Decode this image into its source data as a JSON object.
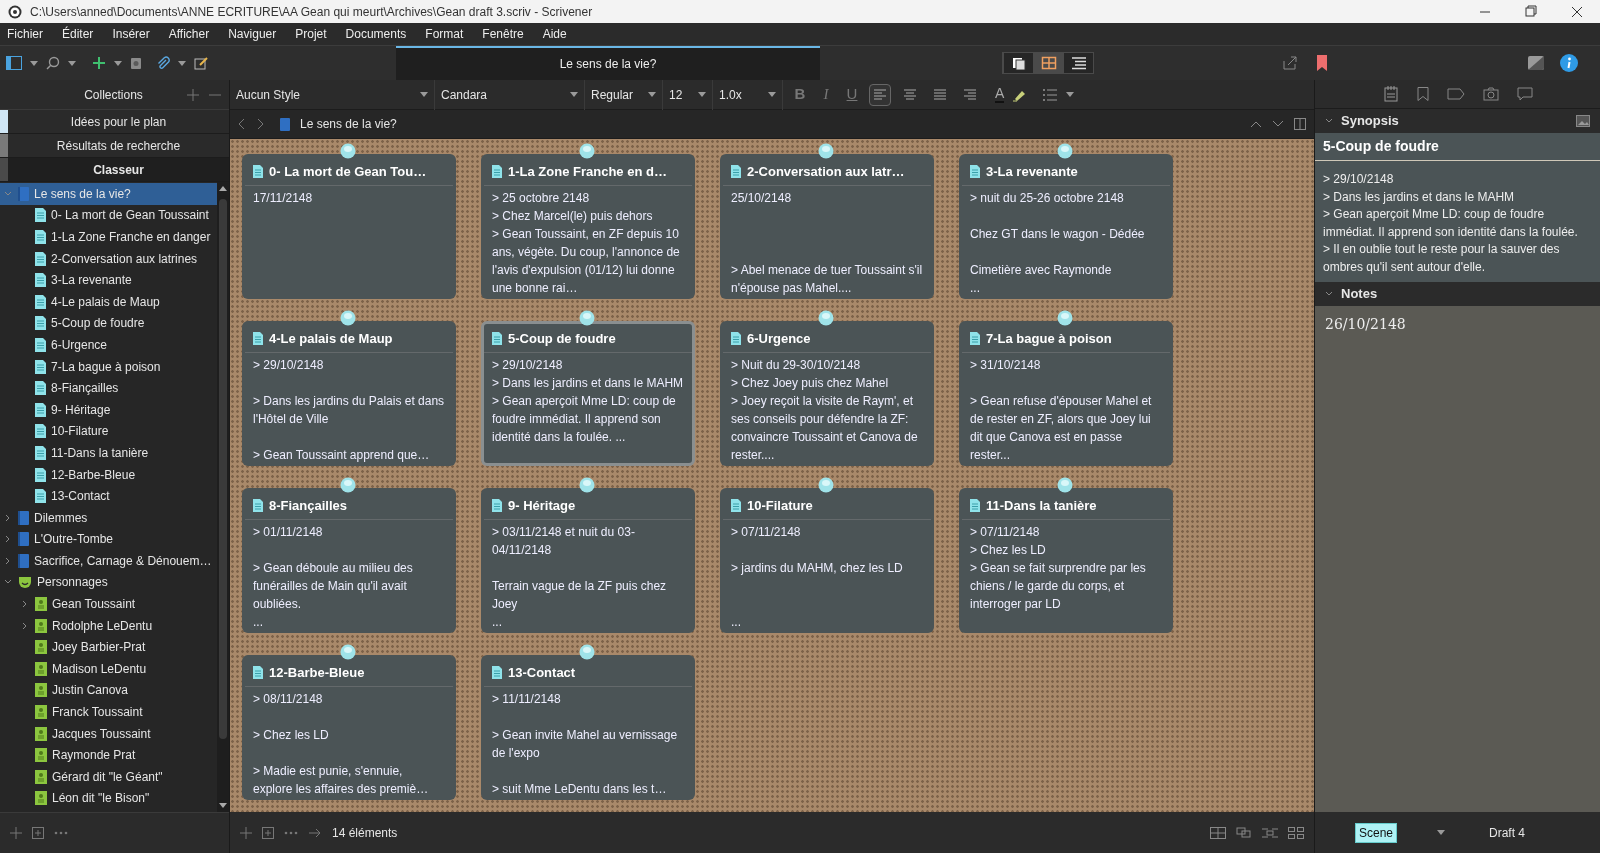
{
  "window": {
    "title": "C:\\Users\\anned\\Documents\\ANNE ECRITURE\\AA Gean qui meurt\\Archives\\Gean draft 3.scriv - Scrivener"
  },
  "menu": [
    "Fichier",
    "Éditer",
    "Insérer",
    "Afficher",
    "Naviguer",
    "Projet",
    "Documents",
    "Format",
    "Fenêtre",
    "Aide"
  ],
  "editor_tab": {
    "label": "Le sens de la vie?"
  },
  "view_modes": [
    {
      "kind": "scrivenings",
      "selected": false
    },
    {
      "kind": "corkboard",
      "selected": true
    },
    {
      "kind": "outline",
      "selected": false
    }
  ],
  "collections": {
    "title": "Collections",
    "items": [
      {
        "label": "Idées pour le plan",
        "selected": false,
        "color": "#cfe6f5"
      },
      {
        "label": "Résultats de recherche",
        "selected": false,
        "color": "#7a7a7a"
      },
      {
        "label": "Classeur",
        "selected": true,
        "color": "#4a4a4a"
      }
    ]
  },
  "binder": [
    {
      "label": "Le sens de la vie?",
      "kind": "folder",
      "expanded": true,
      "selected": true,
      "children": [
        {
          "label": "0- La mort de Gean Toussaint",
          "kind": "scene",
          "selected": false
        },
        {
          "label": "1-La Zone Franche en danger",
          "kind": "scene",
          "selected": false
        },
        {
          "label": "2-Conversation aux latrines",
          "kind": "scene",
          "selected": false
        },
        {
          "label": "3-La revenante",
          "kind": "scene",
          "selected": false
        },
        {
          "label": "4-Le palais de Maup",
          "kind": "scene",
          "selected": false
        },
        {
          "label": "5-Coup de foudre",
          "kind": "scene",
          "selected": false
        },
        {
          "label": "6-Urgence",
          "kind": "scene",
          "selected": false
        },
        {
          "label": "7-La bague à poison",
          "kind": "scene",
          "selected": false
        },
        {
          "label": "8-Fiançailles",
          "kind": "scene",
          "selected": false
        },
        {
          "label": "9- Héritage",
          "kind": "scene",
          "selected": false
        },
        {
          "label": "10-Filature",
          "kind": "scene",
          "selected": false
        },
        {
          "label": "11-Dans la tanière",
          "kind": "scene",
          "selected": false
        },
        {
          "label": "12-Barbe-Bleue",
          "kind": "scene",
          "selected": false
        },
        {
          "label": "13-Contact",
          "kind": "scene",
          "selected": false
        }
      ]
    },
    {
      "label": "Dilemmes",
      "kind": "folder",
      "expanded": false,
      "selected": false
    },
    {
      "label": "L'Outre-Tombe",
      "kind": "folder",
      "expanded": false,
      "selected": false
    },
    {
      "label": "Sacrifice, Carnage & Dénouem…",
      "kind": "folder",
      "expanded": false,
      "selected": false
    },
    {
      "label": "Personnages",
      "kind": "characters",
      "expanded": true,
      "selected": false,
      "children": [
        {
          "label": "Gean Toussaint",
          "kind": "character",
          "expanded": false,
          "selected": false
        },
        {
          "label": "Rodolphe LeDentu",
          "kind": "character",
          "expanded": false,
          "selected": false
        },
        {
          "label": "Joey Barbier-Prat",
          "kind": "character",
          "selected": false
        },
        {
          "label": "Madison LeDentu",
          "kind": "character",
          "selected": false
        },
        {
          "label": "Justin Canova",
          "kind": "character",
          "selected": false
        },
        {
          "label": "Franck Toussaint",
          "kind": "character",
          "selected": false
        },
        {
          "label": "Jacques Toussaint",
          "kind": "character",
          "selected": false
        },
        {
          "label": "Raymonde Prat",
          "kind": "character",
          "selected": false
        },
        {
          "label": "Gérard dit \"le Géant\"",
          "kind": "character",
          "selected": false
        },
        {
          "label": "Léon dit \"le Bison\"",
          "kind": "character",
          "selected": false
        }
      ]
    }
  ],
  "format_bar": {
    "bold": "B",
    "italic": "I",
    "underline": "U",
    "text_color": "A",
    "style": "Aucun Style",
    "font": "Candara",
    "weight": "Regular",
    "size": "12",
    "spacing": "1.0x",
    "alignments": [
      {
        "kind": "left",
        "selected": true
      },
      {
        "kind": "center",
        "selected": false
      },
      {
        "kind": "justify",
        "selected": false
      },
      {
        "kind": "right",
        "selected": false
      }
    ]
  },
  "breadcrumb": "Le sens de la vie?",
  "cards": [
    {
      "title": "0- La mort de Gean Tou…",
      "body": "17/11/2148",
      "selected": false
    },
    {
      "title": "1-La Zone Franche en d…",
      "body": "> 25 octobre 2148\n> Chez Marcel(le) puis dehors\n> Gean Toussaint, en ZF depuis 10 ans, végète. Du coup, l'annonce de l'avis d'expulsion (01/12) lui donne une bonne rai…",
      "selected": false
    },
    {
      "title": "2-Conversation aux latr…",
      "body": "25/10/2148\n\n\n\n> Abel menace de tuer Toussaint s'il n'épouse pas Mahel....",
      "selected": false
    },
    {
      "title": "3-La revenante",
      "body": "> nuit du 25-26 octobre 2148\n\nChez GT dans le wagon - Dédée\n\nCimetière avec Raymonde\n...",
      "selected": false
    },
    {
      "title": "4-Le palais de Maup",
      "body": "> 29/10/2148\n\n> Dans les jardins du Palais et dans l'Hôtel de Ville\n\n> Gean Toussaint apprend que…",
      "selected": false
    },
    {
      "title": "5-Coup de foudre",
      "body": "> 29/10/2148\n> Dans les jardins et dans le MAHM\n> Gean  aperçoit Mme LD: coup de foudre immédiat. Il apprend son identité dans la foulée. ...",
      "selected": true
    },
    {
      "title": "6-Urgence",
      "body": "> Nuit du 29-30/10/2148\n> Chez Joey puis chez Mahel\n> Joey reçoit la visite de Raym', et ses conseils pour défendre la ZF: convaincre Toussaint et Canova de rester....",
      "selected": false
    },
    {
      "title": "7-La bague à poison",
      "body": "> 31/10/2148\n\n> Gean refuse d'épouser Mahel et de rester en ZF, alors que Joey lui dit que Canova est en passe rester...",
      "selected": false
    },
    {
      "title": "8-Fiançailles",
      "body": "> 01/11/2148\n\n> Gean déboule au milieu des funérailles de Main qu'il avait oubliées.\n...",
      "selected": false
    },
    {
      "title": "9- Héritage",
      "body": "> 03/11/2148 et nuit du 03-04/11/2148\n\nTerrain vague de la ZF puis chez Joey\n...",
      "selected": false
    },
    {
      "title": "10-Filature",
      "body": "> 07/11/2148\n\n> jardins du MAHM, chez les LD\n\n\n...",
      "selected": false
    },
    {
      "title": "11-Dans la tanière",
      "body": "> 07/11/2148\n> Chez les LD\n> Gean se fait surprendre par les chiens / le garde du corps, et interroger par LD",
      "selected": false
    },
    {
      "title": "12-Barbe-Bleue",
      "body": "> 08/11/2148\n\n> Chez les LD\n\n> Madie est punie, s'ennuie, explore les affaires des premiè…",
      "selected": false
    },
    {
      "title": "13-Contact",
      "body": "> 11/11/2148\n\n> Gean invite Mahel au vernissage de l'expo\n\n> suit Mme LeDentu dans les t…",
      "selected": false
    }
  ],
  "inspector": {
    "synopsis_header": "Synopsis",
    "title": "5-Coup de foudre",
    "synopsis": "> 29/10/2148\n> Dans les jardins et dans le MAHM\n> Gean  aperçoit Mme LD: coup de foudre immédiat. Il apprend son identité dans la foulée.\n> Il en oublie tout le reste pour la sauver des ombres qu'il sent autour d'elle.",
    "notes_header": "Notes",
    "notes": "26/10/2148"
  },
  "status_bar": {
    "count": "14 éléments",
    "label": "Scene",
    "status": "Draft 4"
  }
}
